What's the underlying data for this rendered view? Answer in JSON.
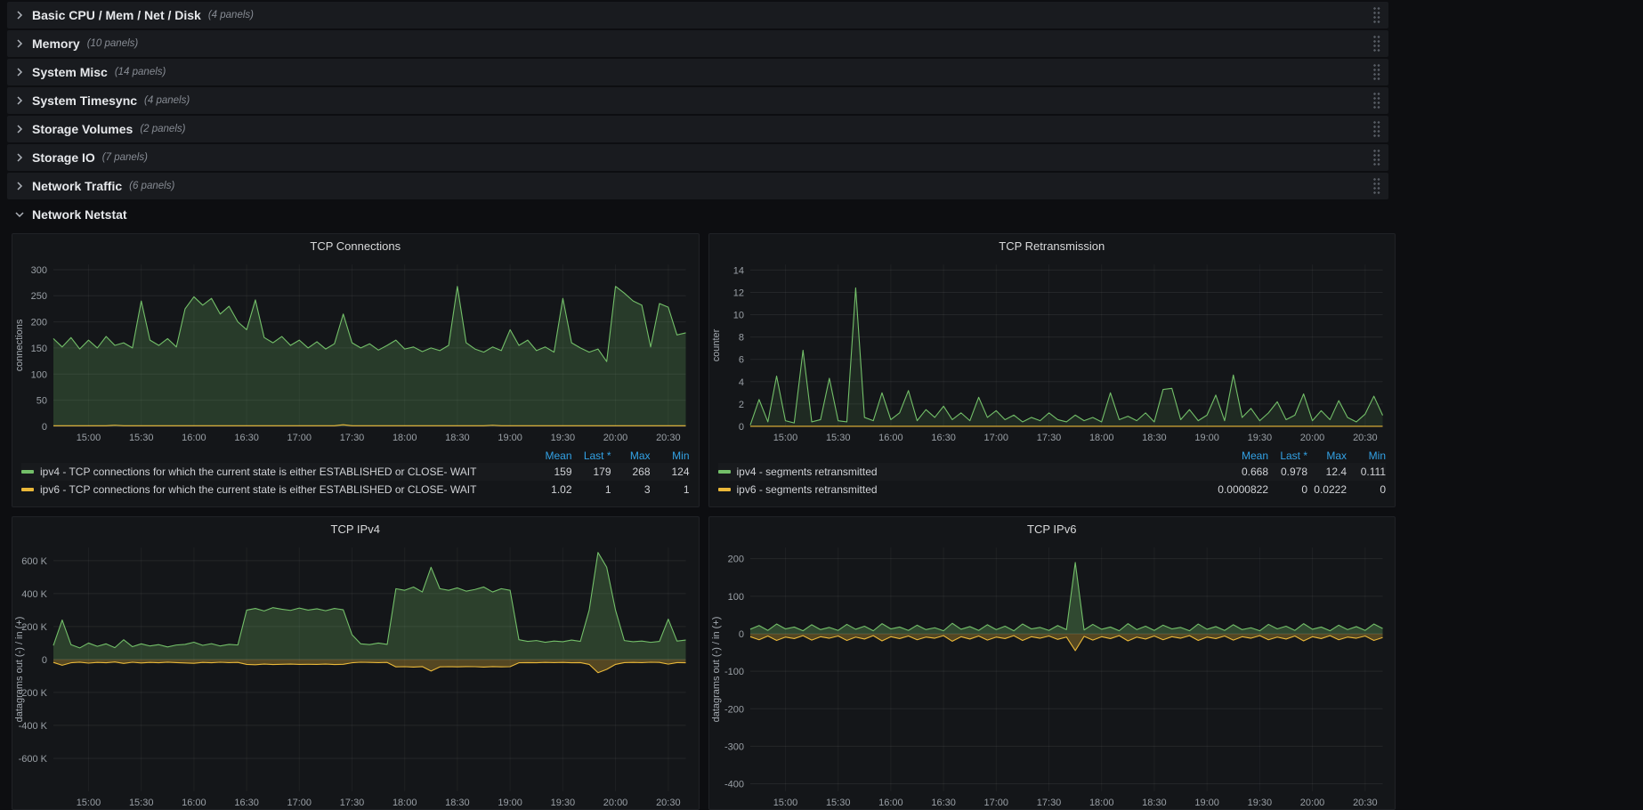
{
  "colors": {
    "green": "#73bf69",
    "yellow": "#eab839",
    "blue": "#33a2e5"
  },
  "rows": [
    {
      "title": "Basic CPU / Mem / Net / Disk",
      "panels": "(4 panels)"
    },
    {
      "title": "Memory",
      "panels": "(10 panels)"
    },
    {
      "title": "System Misc",
      "panels": "(14 panels)"
    },
    {
      "title": "System Timesync",
      "panels": "(4 panels)"
    },
    {
      "title": "Storage Volumes",
      "panels": "(2 panels)"
    },
    {
      "title": "Storage IO",
      "panels": "(7 panels)"
    },
    {
      "title": "Network Traffic",
      "panels": "(6 panels)"
    },
    {
      "title": "Network Netstat",
      "panels": ""
    }
  ],
  "legend_headers": [
    "Mean",
    "Last *",
    "Max",
    "Min"
  ],
  "chart_data": [
    {
      "type": "line",
      "title": "TCP Connections",
      "ylabel": "connections",
      "ylim": [
        0,
        310
      ],
      "y_ticks": [
        {
          "v": 0,
          "t": "0"
        },
        {
          "v": 50,
          "t": "50"
        },
        {
          "v": 100,
          "t": "100"
        },
        {
          "v": 150,
          "t": "150"
        },
        {
          "v": 200,
          "t": "200"
        },
        {
          "v": 250,
          "t": "250"
        },
        {
          "v": 300,
          "t": "300"
        }
      ],
      "x_start": "14:40",
      "x_end": "20:40",
      "x_ticks": [
        "15:00",
        "15:30",
        "16:00",
        "16:30",
        "17:00",
        "17:30",
        "18:00",
        "18:30",
        "19:00",
        "19:30",
        "20:00",
        "20:30"
      ],
      "series": [
        {
          "label": "ipv4 - TCP connections for which the current state is either ESTABLISHED or CLOSE- WAIT",
          "color": "green",
          "fill": 0.22,
          "stats": {
            "mean": "159",
            "last": "179",
            "max": "268",
            "min": "124"
          },
          "values": [
            168,
            152,
            170,
            148,
            165,
            150,
            172,
            155,
            160,
            150,
            240,
            165,
            155,
            168,
            152,
            225,
            248,
            232,
            245,
            215,
            230,
            200,
            185,
            242,
            170,
            160,
            172,
            155,
            165,
            150,
            162,
            148,
            158,
            215,
            160,
            150,
            158,
            146,
            155,
            165,
            148,
            152,
            143,
            150,
            145,
            155,
            268,
            160,
            148,
            142,
            152,
            145,
            185,
            155,
            165,
            145,
            152,
            142,
            245,
            160,
            150,
            142,
            148,
            124,
            268,
            255,
            240,
            232,
            152,
            235,
            228,
            175,
            179
          ]
        },
        {
          "label": "ipv6 - TCP connections for which the current state is either ESTABLISHED or CLOSE- WAIT",
          "color": "yellow",
          "fill": 0,
          "stats": {
            "mean": "1.02",
            "last": "1",
            "max": "3",
            "min": "1"
          },
          "values": [
            1,
            1,
            1,
            1,
            1,
            1,
            1,
            2,
            1,
            1,
            1,
            1,
            1,
            1,
            1,
            1,
            1,
            1,
            1,
            1,
            1,
            1,
            1,
            1,
            1,
            1,
            1,
            1,
            1,
            1,
            1,
            1,
            1,
            3,
            1,
            1,
            1,
            1,
            1,
            1,
            1,
            1,
            1,
            1,
            1,
            1,
            1,
            1,
            1,
            1,
            2,
            1,
            1,
            1,
            1,
            1,
            1,
            1,
            1,
            1,
            1,
            1,
            1,
            1,
            1,
            1,
            1,
            1,
            1,
            1,
            1,
            1,
            1
          ]
        }
      ]
    },
    {
      "type": "line",
      "title": "TCP Retransmission",
      "ylabel": "counter",
      "ylim": [
        0,
        14.5
      ],
      "y_ticks": [
        {
          "v": 0,
          "t": "0"
        },
        {
          "v": 2,
          "t": "2"
        },
        {
          "v": 4,
          "t": "4"
        },
        {
          "v": 6,
          "t": "6"
        },
        {
          "v": 8,
          "t": "8"
        },
        {
          "v": 10,
          "t": "10"
        },
        {
          "v": 12,
          "t": "12"
        },
        {
          "v": 14,
          "t": "14"
        }
      ],
      "x_start": "14:40",
      "x_end": "20:40",
      "x_ticks": [
        "15:00",
        "15:30",
        "16:00",
        "16:30",
        "17:00",
        "17:30",
        "18:00",
        "18:30",
        "19:00",
        "19:30",
        "20:00",
        "20:30"
      ],
      "series": [
        {
          "label": "ipv4 - segments retransmitted",
          "color": "green",
          "fill": 0.12,
          "stats": {
            "mean": "0.668",
            "last": "0.978",
            "max": "12.4",
            "min": "0.111"
          },
          "values": [
            0.111,
            2.4,
            0.4,
            4.5,
            0.5,
            0.3,
            6.8,
            0.4,
            0.6,
            4.3,
            0.5,
            0.4,
            12.4,
            0.8,
            0.5,
            3.0,
            0.6,
            1.2,
            3.2,
            0.5,
            1.5,
            0.8,
            1.8,
            0.6,
            1.2,
            0.5,
            2.6,
            0.8,
            1.4,
            0.6,
            1.0,
            0.4,
            0.8,
            0.5,
            1.2,
            0.6,
            0.4,
            1.0,
            0.5,
            0.8,
            0.4,
            3.0,
            0.6,
            0.9,
            0.5,
            1.2,
            0.4,
            3.3,
            3.4,
            0.6,
            1.5,
            0.5,
            1.0,
            2.8,
            0.5,
            4.6,
            0.8,
            1.6,
            0.5,
            1.2,
            2.2,
            0.6,
            1.0,
            2.9,
            0.5,
            1.4,
            0.6,
            2.3,
            0.8,
            0.4,
            1.1,
            2.7,
            0.978
          ]
        },
        {
          "label": "ipv6 - segments retransmitted",
          "color": "yellow",
          "fill": 0,
          "stats": {
            "mean": "0.0000822",
            "last": "0",
            "max": "0.0222",
            "min": "0"
          },
          "values": [
            0,
            0,
            0,
            0,
            0,
            0,
            0,
            0,
            0,
            0,
            0,
            0,
            0,
            0,
            0,
            0,
            0,
            0,
            0,
            0,
            0,
            0,
            0,
            0,
            0,
            0,
            0,
            0,
            0,
            0,
            0,
            0,
            0,
            0,
            0,
            0,
            0,
            0,
            0,
            0,
            0,
            0,
            0,
            0,
            0,
            0,
            0,
            0,
            0,
            0,
            0,
            0,
            0,
            0,
            0,
            0,
            0,
            0,
            0,
            0,
            0,
            0,
            0,
            0,
            0,
            0,
            0,
            0,
            0,
            0,
            0,
            0,
            0
          ]
        }
      ]
    },
    {
      "type": "line",
      "title": "TCP IPv4",
      "ylabel": "datagrams out (-) / in (+)",
      "ylim": [
        -800,
        680
      ],
      "y_ticks": [
        {
          "v": -600,
          "t": "-600 K"
        },
        {
          "v": -400,
          "t": "-400 K"
        },
        {
          "v": -200,
          "t": "-200 K"
        },
        {
          "v": 0,
          "t": "0"
        },
        {
          "v": 200,
          "t": "200 K"
        },
        {
          "v": 400,
          "t": "400 K"
        },
        {
          "v": 600,
          "t": "600 K"
        }
      ],
      "x_start": "14:40",
      "x_end": "20:40",
      "x_ticks": [
        "15:00",
        "15:30",
        "16:00",
        "16:30",
        "17:00",
        "17:30",
        "18:00",
        "18:30",
        "19:00",
        "19:30",
        "20:00",
        "20:30"
      ],
      "series": [
        {
          "color": "green",
          "fill": 0.25,
          "values": [
            85,
            240,
            90,
            70,
            100,
            80,
            95,
            72,
            120,
            78,
            95,
            82,
            90,
            76,
            88,
            92,
            105,
            86,
            96,
            82,
            92,
            88,
            300,
            310,
            295,
            315,
            305,
            298,
            312,
            300,
            308,
            296,
            310,
            302,
            150,
            95,
            90,
            100,
            92,
            430,
            420,
            440,
            410,
            560,
            430,
            420,
            435,
            415,
            425,
            440,
            410,
            430,
            420,
            120,
            110,
            115,
            105,
            112,
            108,
            118,
            110,
            300,
            650,
            560,
            300,
            115,
            108,
            112,
            104,
            110,
            245,
            112,
            118
          ]
        },
        {
          "color": "yellow",
          "fill": 0.3,
          "values": [
            -18,
            -35,
            -20,
            -16,
            -22,
            -18,
            -20,
            -15,
            -24,
            -17,
            -21,
            -18,
            -20,
            -16,
            -19,
            -21,
            -23,
            -18,
            -20,
            -17,
            -19,
            -18,
            -30,
            -32,
            -28,
            -31,
            -29,
            -28,
            -30,
            -29,
            -30,
            -28,
            -31,
            -29,
            -20,
            -17,
            -18,
            -19,
            -18,
            -45,
            -44,
            -46,
            -43,
            -70,
            -45,
            -44,
            -45,
            -43,
            -44,
            -46,
            -43,
            -45,
            -44,
            -20,
            -19,
            -20,
            -18,
            -19,
            -18,
            -20,
            -19,
            -30,
            -80,
            -60,
            -30,
            -19,
            -18,
            -19,
            -17,
            -18,
            -28,
            -19,
            -20
          ]
        }
      ]
    },
    {
      "type": "line",
      "title": "TCP IPv6",
      "ylabel": "datagrams out (-) / in (+)",
      "ylim": [
        -420,
        230
      ],
      "y_ticks": [
        {
          "v": -400,
          "t": "-400"
        },
        {
          "v": -300,
          "t": "-300"
        },
        {
          "v": -200,
          "t": "-200"
        },
        {
          "v": -100,
          "t": "-100"
        },
        {
          "v": 0,
          "t": "0"
        },
        {
          "v": 100,
          "t": "100"
        },
        {
          "v": 200,
          "t": "200"
        }
      ],
      "x_start": "14:40",
      "x_end": "20:40",
      "x_ticks": [
        "15:00",
        "15:30",
        "16:00",
        "16:30",
        "17:00",
        "17:30",
        "18:00",
        "18:30",
        "19:00",
        "19:30",
        "20:00",
        "20:30"
      ],
      "series": [
        {
          "color": "green",
          "fill": 0.3,
          "values": [
            12,
            22,
            9,
            26,
            13,
            18,
            8,
            24,
            11,
            17,
            9,
            25,
            12,
            20,
            8,
            27,
            13,
            18,
            9,
            23,
            11,
            16,
            8,
            28,
            12,
            19,
            9,
            24,
            11,
            20,
            8,
            26,
            13,
            17,
            9,
            22,
            11,
            190,
            10,
            25,
            12,
            18,
            8,
            27,
            11,
            20,
            9,
            23,
            13,
            17,
            8,
            26,
            12,
            19,
            9,
            24,
            11,
            16,
            8,
            25,
            13,
            20,
            9,
            27,
            12,
            18,
            8,
            23,
            11,
            19,
            9,
            26,
            14
          ]
        },
        {
          "color": "yellow",
          "fill": 0.3,
          "values": [
            -8,
            -16,
            -6,
            -18,
            -9,
            -13,
            -5,
            -17,
            -8,
            -12,
            -6,
            -18,
            -9,
            -14,
            -5,
            -19,
            -8,
            -13,
            -6,
            -16,
            -9,
            -12,
            -5,
            -20,
            -8,
            -14,
            -6,
            -17,
            -9,
            -13,
            -5,
            -18,
            -8,
            -12,
            -6,
            -15,
            -9,
            -45,
            -7,
            -17,
            -8,
            -13,
            -5,
            -19,
            -9,
            -14,
            -6,
            -16,
            -8,
            -12,
            -5,
            -18,
            -9,
            -13,
            -6,
            -17,
            -8,
            -12,
            -5,
            -16,
            -9,
            -14,
            -6,
            -19,
            -8,
            -13,
            -5,
            -16,
            -9,
            -12,
            -6,
            -18,
            -10
          ]
        }
      ]
    }
  ]
}
